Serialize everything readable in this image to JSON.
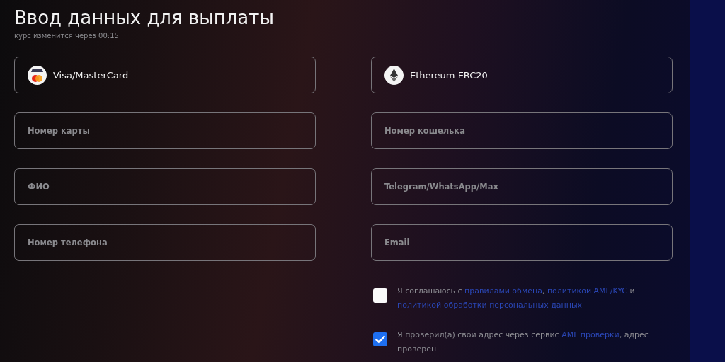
{
  "title": "Ввод данных для выплаты",
  "subtitle": "курс изменится через 00:15",
  "columns": [
    {
      "method": {
        "label": "Visa/MasterCard",
        "kind": "card"
      },
      "fields": [
        {
          "placeholder": "Номер карты"
        },
        {
          "placeholder": "ФИО"
        },
        {
          "placeholder": "Номер телефона"
        }
      ]
    },
    {
      "method": {
        "label": "Ethereum ERC20",
        "kind": "ethereum"
      },
      "fields": [
        {
          "placeholder": "Номер кошелька"
        },
        {
          "placeholder": "Telegram/WhatsApp/Max"
        },
        {
          "placeholder": "Email"
        }
      ]
    }
  ],
  "agreements": [
    {
      "checked": false,
      "parts": [
        {
          "kind": "text",
          "text": "Я соглашаюсь с "
        },
        {
          "kind": "link",
          "text": "правилами обмена"
        },
        {
          "kind": "text",
          "text": ", "
        },
        {
          "kind": "link",
          "text": "политикой AML/KYC"
        },
        {
          "kind": "text",
          "text": " и "
        },
        {
          "kind": "link",
          "text": "политикой обработки персональных данных"
        }
      ]
    },
    {
      "checked": true,
      "parts": [
        {
          "kind": "text",
          "text": "Я проверил(а) свой адрес через сервис "
        },
        {
          "kind": "link",
          "text": "AML проверки"
        },
        {
          "kind": "text",
          "text": ", адрес проверен"
        }
      ]
    }
  ]
}
